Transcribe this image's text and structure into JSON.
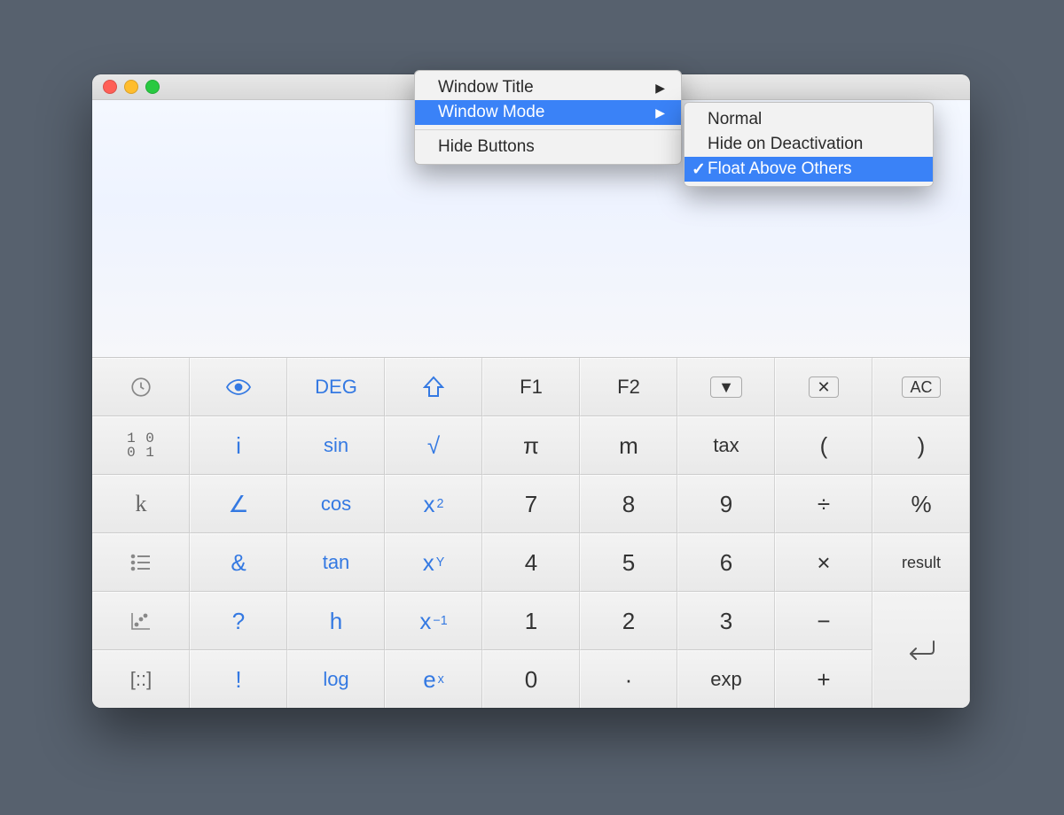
{
  "menu1": {
    "item_window_title": "Window Title",
    "item_window_mode": "Window Mode",
    "item_hide_buttons": "Hide Buttons"
  },
  "menu2": {
    "item_normal": "Normal",
    "item_hide_on_deactivation": "Hide on Deactivation",
    "item_float_above_others": "Float Above Others"
  },
  "row0": {
    "deg": "DEG",
    "f1": "F1",
    "f2": "F2",
    "ac": "AC"
  },
  "row1": {
    "bin": "1 0\n0 1",
    "i": "i",
    "sin": "sin",
    "sqrt": "√",
    "pi": "π",
    "m": "m",
    "tax": "tax",
    "lparen": "(",
    "rparen": ")"
  },
  "row2": {
    "k": "k",
    "angle": "∠",
    "cos": "cos",
    "xsq_base": "x",
    "xsq_sup": "2",
    "d7": "7",
    "d8": "8",
    "d9": "9",
    "div": "÷",
    "pct": "%"
  },
  "row3": {
    "amp": "&",
    "tan": "tan",
    "xy_base": "x",
    "xy_sup": "Y",
    "d4": "4",
    "d5": "5",
    "d6": "6",
    "mul": "×",
    "result": "result"
  },
  "row4": {
    "q": "?",
    "h": "h",
    "xinv_base": "x",
    "xinv_sup": "−1",
    "d1": "1",
    "d2": "2",
    "d3": "3",
    "minus": "−"
  },
  "row5": {
    "brackets": "[::]",
    "excl": "!",
    "log": "log",
    "ex_base": "e",
    "ex_sup": "x",
    "d0": "0",
    "dot": "·",
    "exp": "exp",
    "plus": "+"
  }
}
